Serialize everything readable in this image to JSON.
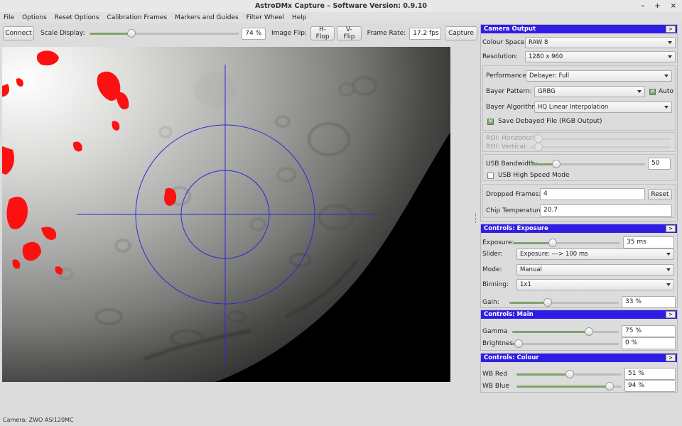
{
  "window": {
    "title": "AstroDMx Capture – Software Version: 0.9.10",
    "min": "–",
    "max": "+",
    "close": "×"
  },
  "menu": [
    "File",
    "Options",
    "Reset Options",
    "Calibration Frames",
    "Markers and Guides",
    "Filter Wheel",
    "Help"
  ],
  "toolbar": {
    "connect": "Connect",
    "scale_label": "Scale Display:",
    "scale_value": "74 %",
    "scale_fraction": 0.25,
    "flip_label": "Image Flip:",
    "hflop": "H-Flop",
    "vflip": "V-Flip",
    "framerate_label": "Frame Rate:",
    "framerate_value": "17.2 fps",
    "capture": "Capture"
  },
  "camera_output": {
    "title": "Camera Output",
    "expand": ">",
    "colour_space_label": "Colour Space:",
    "colour_space": "RAW 8",
    "resolution_label": "Resolution:",
    "resolution": "1280 x 960",
    "performance_label": "Performance:",
    "performance": "Debayer: Full",
    "bayer_pattern_label": "Bayer Pattern:",
    "bayer_pattern": "GRBG",
    "auto_label": "Auto",
    "bayer_algorithm_label": "Bayer Algorithm:",
    "bayer_algorithm": "HQ Linear Interpolation",
    "save_debayed_label": "Save Debayed File (RGB Output)",
    "roi_h_label": "ROI: Horizontal:",
    "roi_v_label": "ROI: Vertical:",
    "usb_bandwidth_label": "USB Bandwidth:",
    "usb_bandwidth": "50",
    "usb_bandwidth_fraction": 0.18,
    "usb_high_speed_label": "USB High Speed Mode",
    "dropped_frames_label": "Dropped Frames:",
    "dropped_frames": "4",
    "reset": "Reset",
    "chip_temp_label": "Chip Temperature:",
    "chip_temp": "20.7"
  },
  "exposure": {
    "title": "Controls: Exposure",
    "expand": ">",
    "exposure_label": "Exposure:",
    "exposure_value": "35 ms",
    "exposure_fraction": 0.35,
    "slider_label": "Slider:",
    "slider_value": "Exposure: ---> 100 ms",
    "mode_label": "Mode:",
    "mode_value": "Manual",
    "binning_label": "Binning:",
    "binning_value": "1x1",
    "gain_label": "Gain:",
    "gain_value": "33 %",
    "gain_fraction": 0.33
  },
  "main": {
    "title": "Controls: Main",
    "expand": ">",
    "gamma_label": "Gamma",
    "gamma_value": "75 %",
    "gamma_fraction": 0.75,
    "brightness_label": "Brightnes",
    "brightness_value": "0 %",
    "brightness_fraction": 0.0
  },
  "colour": {
    "title": "Controls: Colour",
    "expand": ">",
    "wb_red_label": "WB Red",
    "wb_red_value": "51 %",
    "wb_red_fraction": 0.51,
    "wb_blue_label": "WB Blue",
    "wb_blue_value": "94 %",
    "wb_blue_fraction": 0.94
  },
  "status": "Camera: ZWO ASI120MC",
  "colors": {
    "panel_header": "#2f1de6",
    "reticle": "#2a2ad8",
    "overexposed": "#ff0000"
  }
}
